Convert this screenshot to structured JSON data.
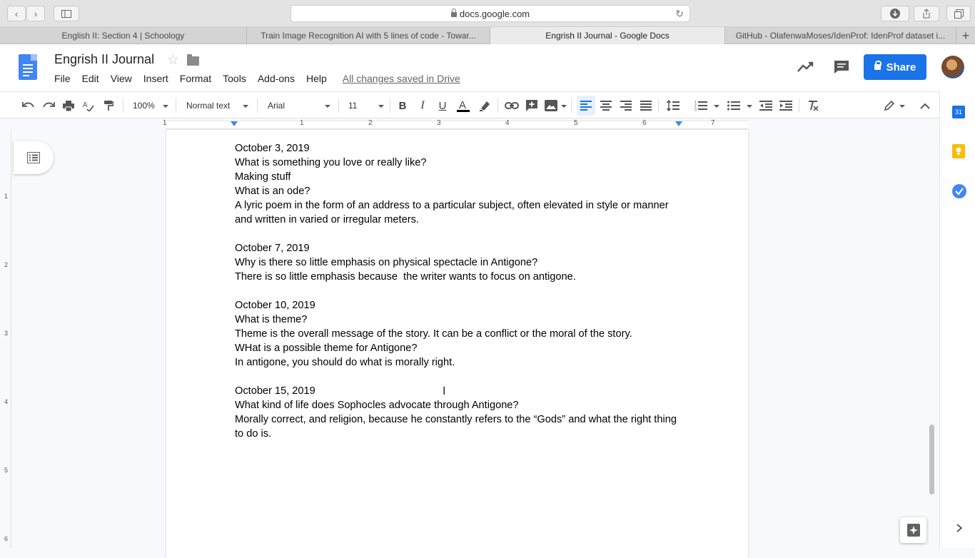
{
  "browser": {
    "url": "docs.google.com",
    "tabs": [
      {
        "label": "English II: Section 4 | Schoology",
        "active": false
      },
      {
        "label": "Train Image Recognition AI with 5 lines of code - Towar...",
        "active": false
      },
      {
        "label": "Engrish II Journal - Google Docs",
        "active": true
      },
      {
        "label": "GitHub - OlafenwaMoses/IdenProf: IdenProf dataset i...",
        "active": false
      }
    ],
    "new_tab": "+"
  },
  "docs": {
    "title": "Engrish II Journal",
    "menu": [
      "File",
      "Edit",
      "View",
      "Insert",
      "Format",
      "Tools",
      "Add-ons",
      "Help"
    ],
    "save_status": "All changes saved in Drive",
    "share_label": "Share",
    "accent_color": "#1a73e8"
  },
  "toolbar": {
    "zoom": "100%",
    "style": "Normal text",
    "font": "Arial",
    "font_size": "11"
  },
  "ruler": {
    "numbers": [
      "1",
      "1",
      "2",
      "3",
      "4",
      "5",
      "6",
      "7"
    ],
    "vertical_numbers": [
      "1",
      "2",
      "3",
      "4",
      "5",
      "6"
    ]
  },
  "side_panel": {
    "calendar_day": "31"
  },
  "document": {
    "paragraphs": [
      "October 3, 2019",
      "What is something you love or really like?",
      "Making stuff",
      "What is an ode?",
      "A lyric poem in the form of an address to a particular subject, often elevated in style or manner and written in varied or irregular meters.",
      "",
      "October 7, 2019",
      "Why is there so little emphasis on physical spectacle in Antigone?",
      "There is so little emphasis because  the writer wants to focus on antigone.",
      "",
      "October 10, 2019",
      "What is theme?",
      "Theme is the overall message of the story. It can be a conflict or the moral of the story.",
      "WHat is a possible theme for Antigone?",
      "In antigone, you should do what is morally right.",
      "",
      "October 15, 2019",
      "What kind of life does Sophocles advocate through Antigone?",
      "Morally correct, and religion, because he constantly refers to the “Gods” and what the right thing to do is."
    ]
  }
}
